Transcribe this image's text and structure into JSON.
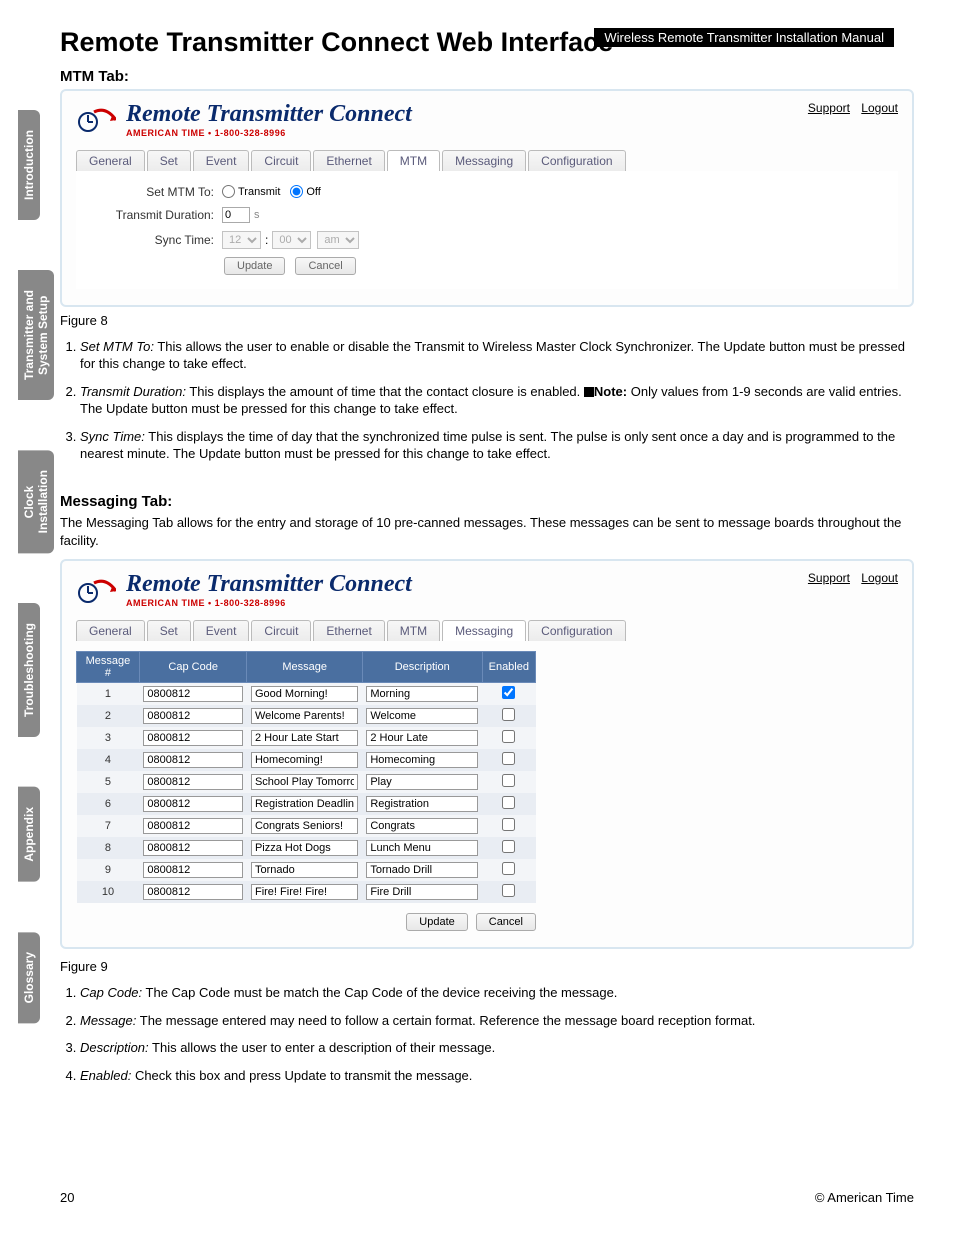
{
  "doc": {
    "badge": "Wireless Remote Transmitter Installation Manual",
    "title": "Remote Transmitter Connect Web Interface",
    "page_num": "20",
    "copyright": "© American Time"
  },
  "side_tabs": [
    "Introduction",
    "Transmitter and\nSystem Setup",
    "Clock\nInstallation",
    "Troubleshooting",
    "Appendix",
    "Glossary"
  ],
  "brand": {
    "title": "Remote Transmitter Connect",
    "sub": "AMERICAN TIME • 1-800-328-8996"
  },
  "links": {
    "support": "Support",
    "logout": "Logout"
  },
  "tabs": [
    "General",
    "Set",
    "Event",
    "Circuit",
    "Ethernet",
    "MTM",
    "Messaging",
    "Configuration"
  ],
  "mtm": {
    "heading": "MTM Tab:",
    "active_tab": "MTM",
    "labels": {
      "set": "Set MTM To:",
      "duration": "Transmit Duration:",
      "sync": "Sync Time:"
    },
    "radio": {
      "transmit": "Transmit",
      "off": "Off",
      "selected": "Off"
    },
    "duration_value": "0",
    "duration_unit": "s",
    "sync_hour": "12",
    "sync_min": "00",
    "sync_ampm": "am",
    "buttons": {
      "update": "Update",
      "cancel": "Cancel"
    },
    "figure": "Figure 8",
    "notes": [
      {
        "label": "Set MTM To:",
        "text": "This allows the user to enable or disable the Transmit to Wireless Master Clock Synchronizer. The Update button must be pressed for this change to take effect."
      },
      {
        "label": "Transmit Duration:",
        "text": "This displays the amount of time that the contact closure is enabled.",
        "note": "Note:",
        "note_text": "Only values from 1-9 seconds are valid entries. The Update button must be pressed for this change to take effect."
      },
      {
        "label": "Sync Time:",
        "text": "This displays the time of day that the synchronized time pulse is sent. The pulse is only sent once a day and is  programmed to the nearest minute. The Update button must be pressed for this change to take effect."
      }
    ]
  },
  "messaging": {
    "heading": "Messaging Tab:",
    "intro": "The Messaging Tab allows for the entry and storage of 10 pre-canned messages. These messages can be sent to message boards throughout the facility.",
    "active_tab": "Messaging",
    "columns": [
      "Message #",
      "Cap Code",
      "Message",
      "Description",
      "Enabled"
    ],
    "rows": [
      {
        "num": "1",
        "cap": "0800812",
        "msg": "Good Morning!",
        "desc": "Morning",
        "enabled": true
      },
      {
        "num": "2",
        "cap": "0800812",
        "msg": "Welcome Parents!",
        "desc": "Welcome",
        "enabled": false
      },
      {
        "num": "3",
        "cap": "0800812",
        "msg": "2 Hour Late Start",
        "desc": "2 Hour Late",
        "enabled": false
      },
      {
        "num": "4",
        "cap": "0800812",
        "msg": "Homecoming!",
        "desc": "Homecoming",
        "enabled": false
      },
      {
        "num": "5",
        "cap": "0800812",
        "msg": "School Play Tomorrow",
        "desc": "Play",
        "enabled": false
      },
      {
        "num": "6",
        "cap": "0800812",
        "msg": "Registration Deadlines!",
        "desc": "Registration",
        "enabled": false
      },
      {
        "num": "7",
        "cap": "0800812",
        "msg": "Congrats Seniors!",
        "desc": "Congrats",
        "enabled": false
      },
      {
        "num": "8",
        "cap": "0800812",
        "msg": "Pizza Hot Dogs",
        "desc": "Lunch Menu",
        "enabled": false
      },
      {
        "num": "9",
        "cap": "0800812",
        "msg": "Tornado",
        "desc": "Tornado Drill",
        "enabled": false
      },
      {
        "num": "10",
        "cap": "0800812",
        "msg": "Fire! Fire! Fire!",
        "desc": "Fire Drill",
        "enabled": false
      }
    ],
    "buttons": {
      "update": "Update",
      "cancel": "Cancel"
    },
    "figure": "Figure 9",
    "notes": [
      {
        "label": "Cap Code:",
        "text": "The Cap Code must be match the Cap Code of the device receiving the message."
      },
      {
        "label": "Message:",
        "text": "The message entered may need to follow a certain format. Reference the message board reception format."
      },
      {
        "label": "Description:",
        "text": "This allows the user to enter a description of their message."
      },
      {
        "label": "Enabled:",
        "text": "Check this box and press Update to transmit the message."
      }
    ]
  }
}
